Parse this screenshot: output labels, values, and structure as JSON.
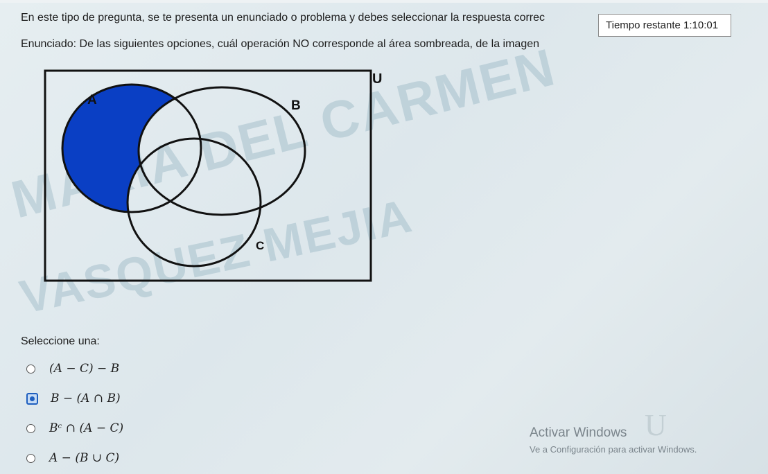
{
  "question": {
    "intro": "En este tipo de pregunta, se te presenta un enunciado o problema y debes seleccionar la respuesta correc",
    "statement": "Enunciado: De las siguientes opciones, cuál operación NO corresponde al área sombreada, de la imagen"
  },
  "timer": {
    "label": "Tiempo restante",
    "value": "1:10:01"
  },
  "venn": {
    "universe_label": "U",
    "set_labels": [
      "A",
      "B",
      "C"
    ],
    "shade_color": "#0a3fc4",
    "shaded_region": "A - (B ∪ C)"
  },
  "watermark": {
    "line1": "MARIA DEL CARMEN",
    "line2": "VASQUEZ MEJIA"
  },
  "answers": {
    "select_label": "Seleccione una:",
    "selected_index": 1,
    "options": [
      {
        "text": "(A − C) − B"
      },
      {
        "text": "B − (A ∩ B)"
      },
      {
        "text": "Bᶜ ∩ (A − C)"
      },
      {
        "text": "A − (B ∪ C)"
      }
    ]
  },
  "os_overlay": {
    "title": "Activar Windows",
    "subtitle": "Ve a Configuración para activar Windows."
  }
}
